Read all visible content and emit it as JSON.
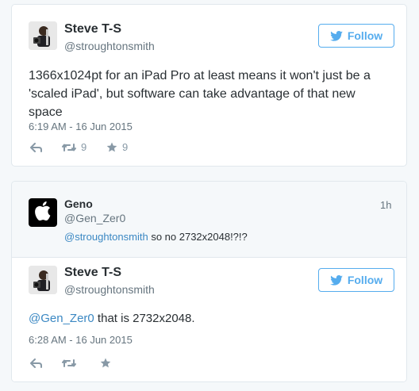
{
  "tweet1": {
    "author_name": "Steve T-S",
    "author_handle": "@stroughtonsmith",
    "follow_label": "Follow",
    "text": "1366x1024pt for an iPad Pro at least means it won't just be a 'scaled iPad', but software can take advantage of that new space",
    "timestamp": "6:19 AM - 16 Jun 2015",
    "retweet_count": "9",
    "favorite_count": "9"
  },
  "conversation": {
    "parent": {
      "author_name": "Geno",
      "author_handle": "@Gen_Zer0",
      "relative_time": "1h",
      "mention": "@stroughtonsmith",
      "text": " so no 2732x2048!?!?"
    },
    "reply": {
      "author_name": "Steve T-S",
      "author_handle": "@stroughtonsmith",
      "follow_label": "Follow",
      "mention": "@Gen_Zer0",
      "text": " that is 2732x2048.",
      "timestamp": "6:28 AM - 16 Jun 2015"
    }
  },
  "colors": {
    "accent": "#55acee",
    "link": "#3b88c3",
    "muted": "#66757f",
    "icon": "#8899a6"
  },
  "icons": [
    "reply-icon",
    "retweet-icon",
    "favorite-star-icon",
    "twitter-bird-icon",
    "apple-logo-icon"
  ]
}
